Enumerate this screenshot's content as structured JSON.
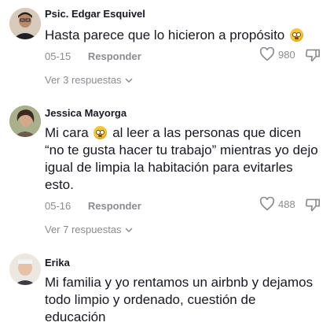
{
  "comments": [
    {
      "author": "Psic. Edgar Esquivel",
      "text": "Hasta parece que lo hicieron a propósito",
      "date": "05-15",
      "reply_label": "Responder",
      "likes": "980",
      "view_replies": "Ver 3 respuestas",
      "emoji": "flushed-face"
    },
    {
      "author": "Jessica Mayorga",
      "text_before_emoji": "Mi cara",
      "text_after_emoji": "al leer a las personas que dicen “no te gusta hacer tu trabajo” mientras yo dejo igual de limpia la habitación para evitarles esto.",
      "date": "05-16",
      "reply_label": "Responder",
      "likes": "488",
      "view_replies": "Ver 7 respuestas",
      "emoji": "flushed-face"
    },
    {
      "author": "Erika",
      "text": "Mi familia y yo rentamos un airbnb y dejamos todo limpio y ordenado, cuestión de educación"
    }
  ],
  "colors": {
    "text_primary": "#161823",
    "text_secondary": "#8a8b91",
    "emoji": "#f7c53a"
  }
}
